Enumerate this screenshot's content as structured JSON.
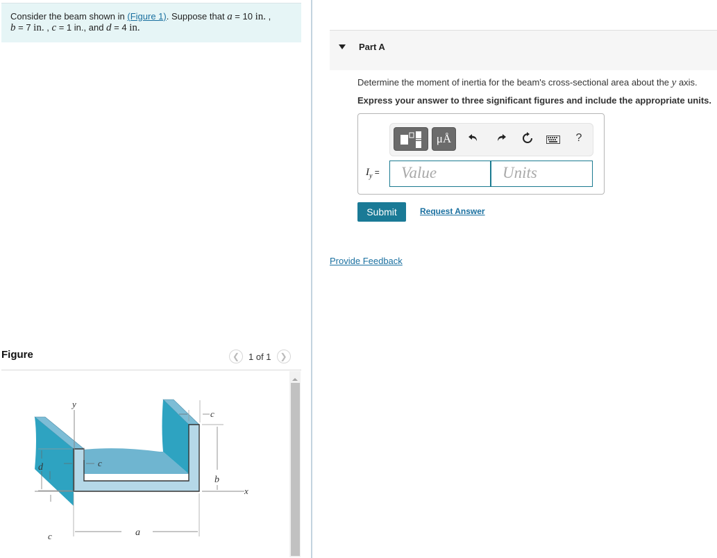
{
  "problem": {
    "intro": "Consider the beam shown in ",
    "figure_link": "(Figure 1)",
    "suppose": ". Suppose that ",
    "a_var": "a",
    "a_val": " = 10 ",
    "a_unit": "in.",
    "sep1": " ,",
    "b_var": "b",
    "b_val": " = 7 ",
    "b_unit": "in.",
    "sep2": " , ",
    "c_var": "c",
    "c_val": " = 1 ",
    "c_unit": "in.",
    "sep3": ", and ",
    "d_var": "d",
    "d_val": " = 4 ",
    "d_unit": "in."
  },
  "figure": {
    "title": "Figure",
    "pager": "1 of 1",
    "prev_icon": "chevron-left",
    "next_icon": "chevron-right",
    "labels": {
      "y": "y",
      "x": "x",
      "a": "a",
      "b": "b",
      "c": "c",
      "d": "d"
    },
    "colors": {
      "dark_face": "#2ea3c1",
      "mid_face": "#6fb5d0",
      "light_face": "#b5d8e8",
      "top_face": "#7dbdd6"
    }
  },
  "part": {
    "title": "Part A",
    "question_pre": "Determine the moment of inertia for the beam's cross-sectional area about the ",
    "question_var": "y",
    "question_post": " axis.",
    "instruction": "Express your answer to three significant figures and include the appropriate units."
  },
  "toolbar": {
    "templates_icon": "templates-icon",
    "units_label": "μÅ",
    "undo_icon": "↰",
    "redo_icon": "↱",
    "reset_icon": "↻",
    "keyboard_icon": "⌨",
    "help_label": "?"
  },
  "answer": {
    "label_var": "I",
    "label_sub": "y",
    "label_eq": " =",
    "value_placeholder": "Value",
    "units_placeholder": "Units",
    "value": "",
    "units": ""
  },
  "actions": {
    "submit": "Submit",
    "request_answer": "Request Answer",
    "feedback": "Provide Feedback"
  },
  "theme": {
    "accent": "#1a7a96",
    "link": "#1a70a0",
    "problem_bg": "#e6f5f6"
  }
}
